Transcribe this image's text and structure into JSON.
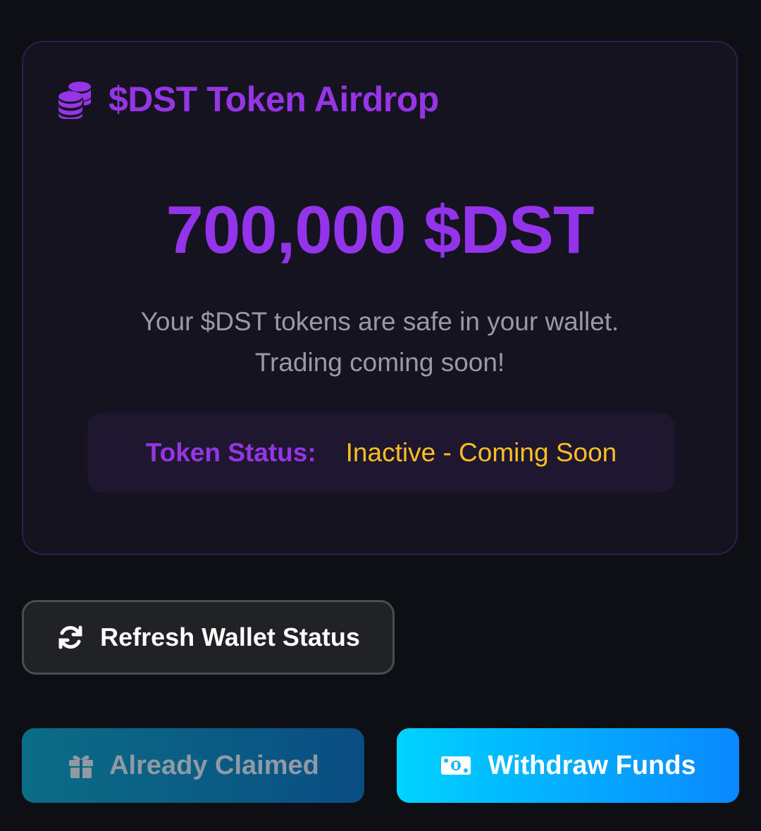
{
  "airdrop_card": {
    "title": "$DST Token Airdrop",
    "amount": "700,000 $DST",
    "subtitle_line1": "Your $DST tokens are safe in your wallet.",
    "subtitle_line2": "Trading coming soon!",
    "status_label": "Token Status:",
    "status_value": "Inactive - Coming Soon"
  },
  "actions": {
    "refresh_label": "Refresh Wallet Status",
    "claimed_label": "Already Claimed",
    "withdraw_label": "Withdraw Funds"
  },
  "icons": {
    "title_icon": "coins-icon",
    "refresh_icon": "refresh-icon",
    "claimed_icon": "gift-icon",
    "withdraw_icon": "money-bill-icon"
  },
  "colors": {
    "background": "#0e0f14",
    "accent_purple": "#9333ea",
    "status_amber": "#fbbf24",
    "withdraw_gradient_start": "#00d2ff",
    "withdraw_gradient_end": "#0a88ff"
  }
}
